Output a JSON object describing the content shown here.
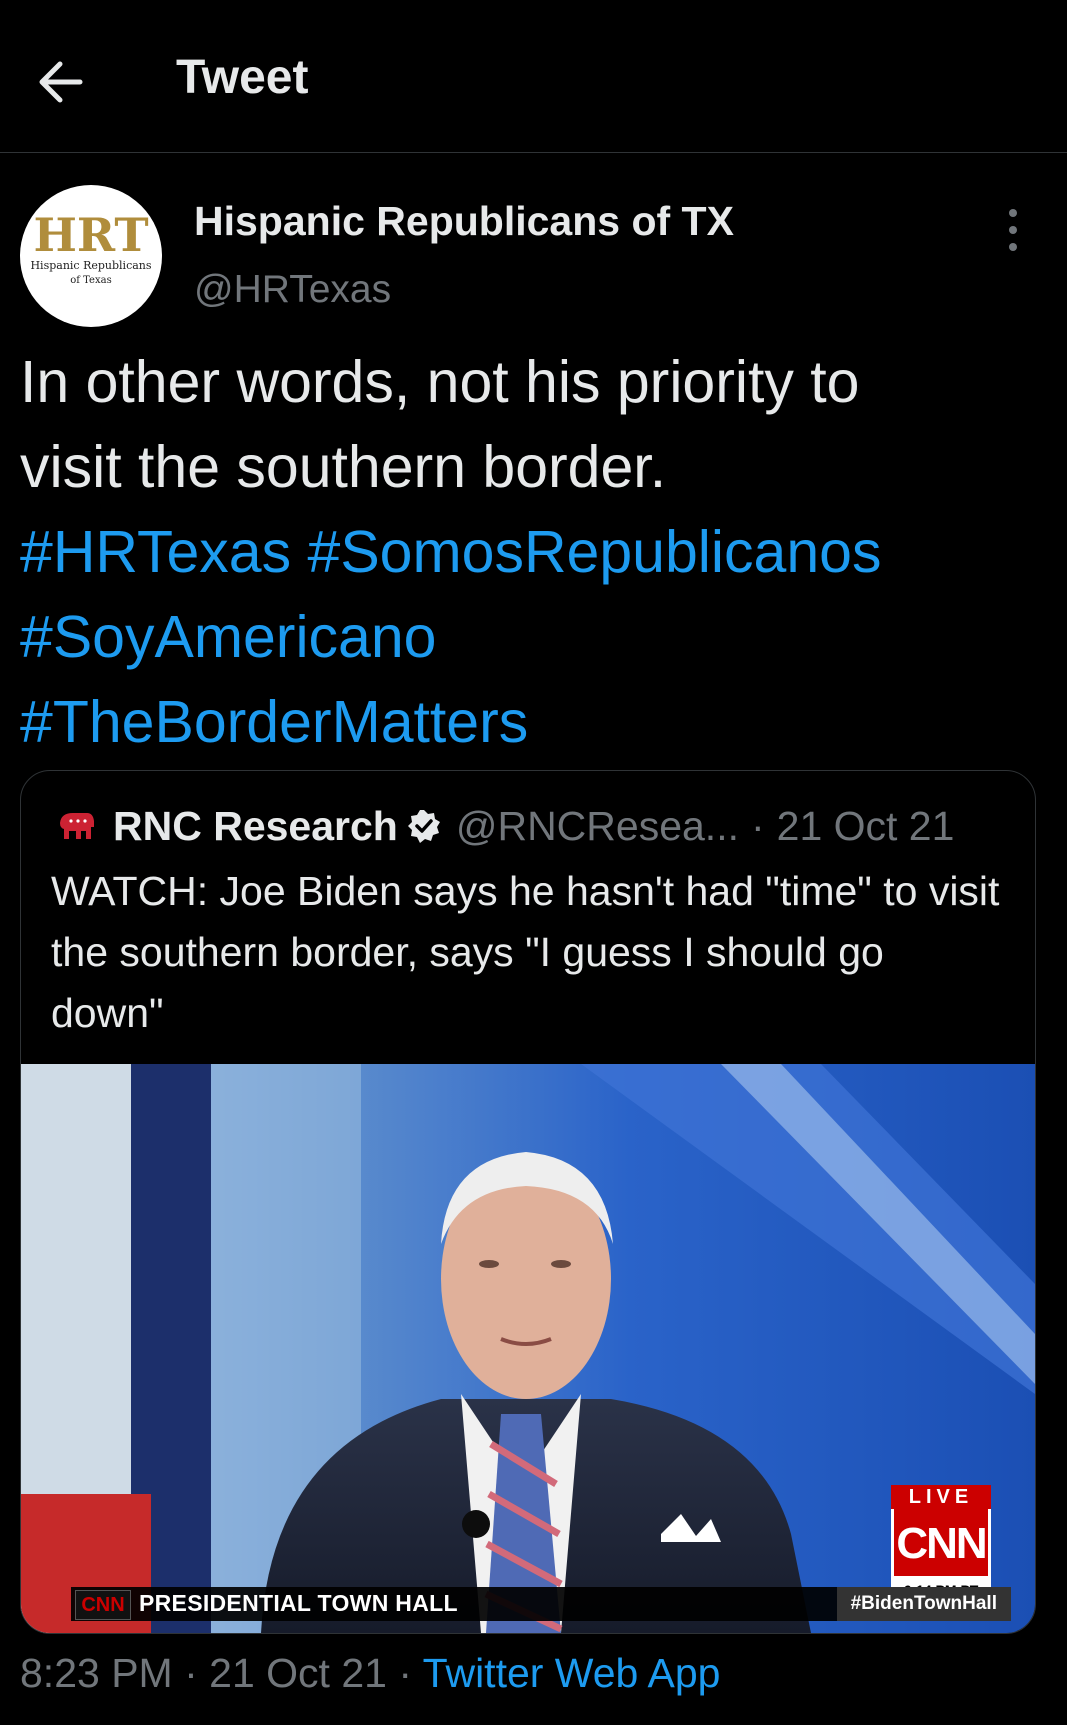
{
  "header": {
    "title": "Tweet",
    "back_icon": "arrow-left-icon"
  },
  "author": {
    "name": "Hispanic Republicans of TX",
    "handle": "@HRTexas",
    "avatar": {
      "logo_text": "HRT",
      "logo_subtitle_1": "Hispanic Republicans",
      "logo_subtitle_2": "of Texas"
    },
    "more_icon": "more-vertical-icon"
  },
  "tweet": {
    "text_line1": "In other words, not his priority to",
    "text_line2": "visit the southern border.",
    "hashtags": [
      "#HRTexas",
      "#SomosRepublicanos",
      "#SoyAmericano",
      "#TheBorderMatters"
    ]
  },
  "quote": {
    "name": "RNC Research",
    "handle": "@RNCResea...",
    "separator": "·",
    "date": "21 Oct 21",
    "text": "WATCH: Joe Biden says he hasn't had \"time\" to visit the southern border, says \"I guess I should go down\"",
    "media": {
      "lower_third_logo": "CNN",
      "lower_third_text": "PRESIDENTIAL TOWN HALL",
      "lower_third_hashtag": "#BidenTownHall",
      "live_label": "LIVE",
      "network_logo": "CNN",
      "time": "6:14 PM PT"
    }
  },
  "footer": {
    "time": "8:23 PM",
    "sep1": "·",
    "date": "21 Oct 21",
    "sep2": "·",
    "app": "Twitter Web App"
  },
  "colors": {
    "background": "#000000",
    "text": "#e7e9ea",
    "muted": "#71767b",
    "link": "#1d9bf0",
    "border": "#2f3336"
  }
}
